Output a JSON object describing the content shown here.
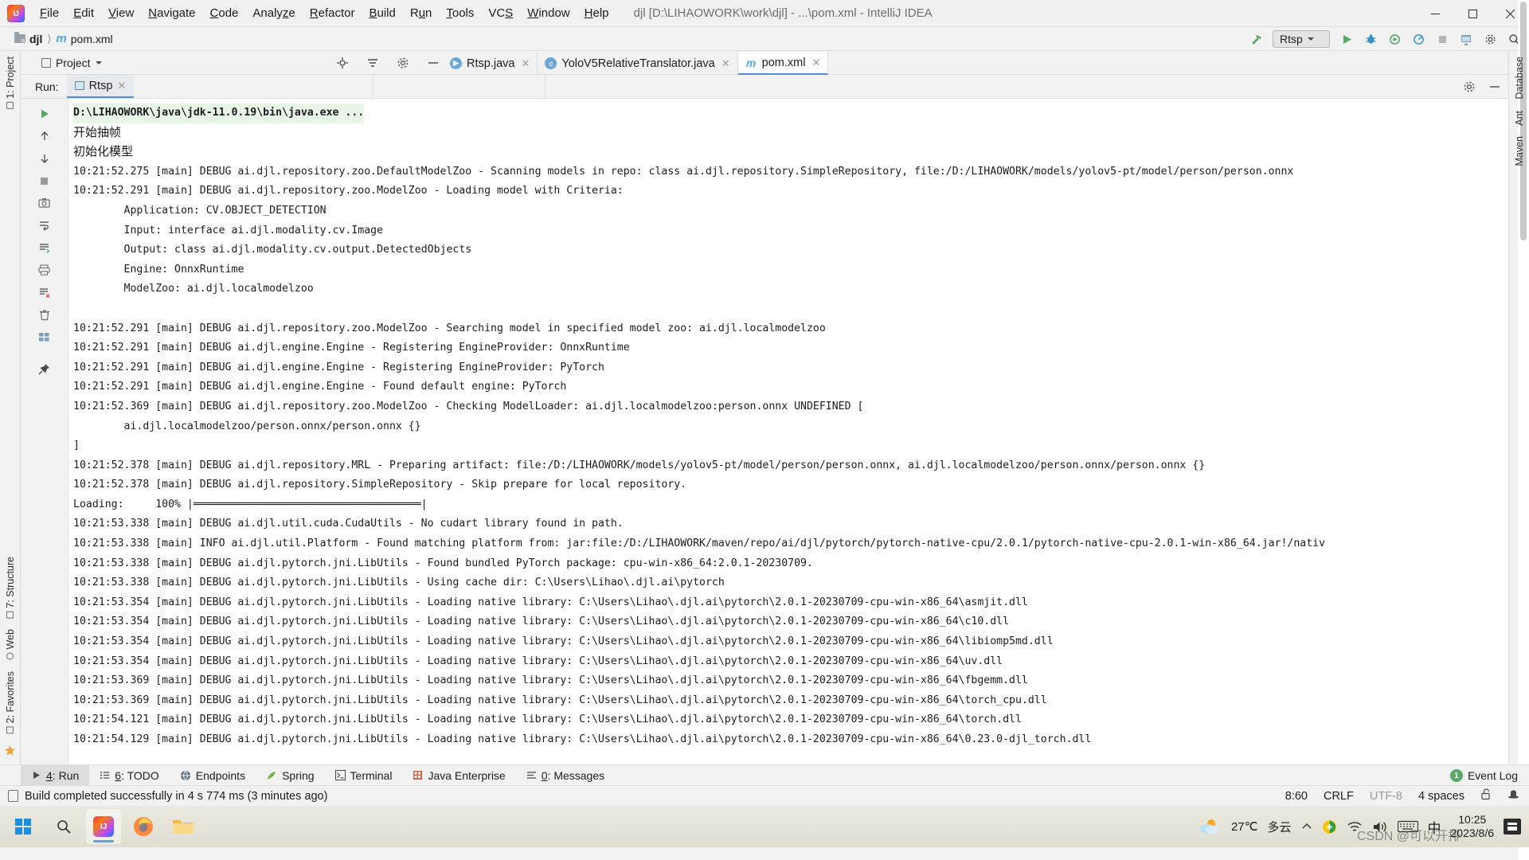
{
  "titlebar": {
    "logo": "intellij-logo",
    "menus": [
      "File",
      "Edit",
      "View",
      "Navigate",
      "Code",
      "Analyze",
      "Refactor",
      "Build",
      "Run",
      "Tools",
      "VCS",
      "Window",
      "Help"
    ],
    "window_title": "djl [D:\\LIHAOWORK\\work\\djl] - ...\\pom.xml - IntelliJ IDEA",
    "controls": [
      "minimize",
      "maximize",
      "close"
    ]
  },
  "navbar": {
    "crumbs": [
      "djl",
      "pom.xml"
    ],
    "separator": "〉",
    "run_config": "Rtsp",
    "icons": [
      "build-hammer-icon",
      "run-icon",
      "debug-icon",
      "run-coverage-icon",
      "profile-icon",
      "stop-icon",
      "updates-icon",
      "settings-icon",
      "search-everywhere-icon"
    ]
  },
  "tool_header": {
    "project_label": "Project",
    "icons": [
      "locate-icon",
      "collapse-all-icon",
      "settings-gear-icon",
      "hide-icon"
    ]
  },
  "editor_tabs": [
    {
      "label": "Rtsp.java",
      "icon": "java-run-icon",
      "active": false,
      "closable": true
    },
    {
      "label": "YoloV5RelativeTranslator.java",
      "icon": "java-class-icon",
      "active": false,
      "closable": true
    },
    {
      "label": "pom.xml",
      "icon": "maven-m-icon",
      "active": true,
      "closable": true
    }
  ],
  "run_panel": {
    "label": "Run:",
    "tab": "Rtsp",
    "gutter_icons": [
      "rerun-icon",
      "up-arrow-icon",
      "down-arrow-icon",
      "stop-icon",
      "camera-icon",
      "soft-wrap-icon",
      "scroll-to-end-icon",
      "print-icon",
      "clear-all-icon",
      "trash-icon",
      "layout-icon",
      "pin-icon"
    ],
    "header_icons": [
      "settings-gear-icon",
      "hide-icon"
    ]
  },
  "left_rail": {
    "top_tab": "1: Project",
    "bottom_tabs": [
      "7: Structure",
      "Web",
      "2: Favorites"
    ],
    "icons": [
      "project-icon",
      "structure-icon",
      "web-icon",
      "favorites-icon",
      "bookmarks-star-icon"
    ]
  },
  "right_rail": {
    "tabs": [
      "Database",
      "Ant",
      "Maven"
    ]
  },
  "console": {
    "lines": [
      {
        "text": "D:\\LIHAOWORK\\java\\jdk-11.0.19\\bin\\java.exe ...",
        "style": "cmd"
      },
      {
        "text": "开始抽帧",
        "style": "cn"
      },
      {
        "text": "初始化模型",
        "style": "cn"
      },
      {
        "text": "10:21:52.275 [main] DEBUG ai.djl.repository.zoo.DefaultModelZoo - Scanning models in repo: class ai.djl.repository.SimpleRepository, file:/D:/LIHAOWORK/models/yolov5-pt/model/person/person.onnx",
        "style": ""
      },
      {
        "text": "10:21:52.291 [main] DEBUG ai.djl.repository.zoo.ModelZoo - Loading model with Criteria:",
        "style": ""
      },
      {
        "text": "\tApplication: CV.OBJECT_DETECTION",
        "style": ""
      },
      {
        "text": "\tInput: interface ai.djl.modality.cv.Image",
        "style": ""
      },
      {
        "text": "\tOutput: class ai.djl.modality.cv.output.DetectedObjects",
        "style": ""
      },
      {
        "text": "\tEngine: OnnxRuntime",
        "style": ""
      },
      {
        "text": "\tModelZoo: ai.djl.localmodelzoo",
        "style": ""
      },
      {
        "text": "",
        "style": ""
      },
      {
        "text": "10:21:52.291 [main] DEBUG ai.djl.repository.zoo.ModelZoo - Searching model in specified model zoo: ai.djl.localmodelzoo",
        "style": ""
      },
      {
        "text": "10:21:52.291 [main] DEBUG ai.djl.engine.Engine - Registering EngineProvider: OnnxRuntime",
        "style": ""
      },
      {
        "text": "10:21:52.291 [main] DEBUG ai.djl.engine.Engine - Registering EngineProvider: PyTorch",
        "style": ""
      },
      {
        "text": "10:21:52.291 [main] DEBUG ai.djl.engine.Engine - Found default engine: PyTorch",
        "style": ""
      },
      {
        "text": "10:21:52.369 [main] DEBUG ai.djl.repository.zoo.ModelZoo - Checking ModelLoader: ai.djl.localmodelzoo:person.onnx UNDEFINED [",
        "style": ""
      },
      {
        "text": "\tai.djl.localmodelzoo/person.onnx/person.onnx {}",
        "style": ""
      },
      {
        "text": "]",
        "style": ""
      },
      {
        "text": "10:21:52.378 [main] DEBUG ai.djl.repository.MRL - Preparing artifact: file:/D:/LIHAOWORK/models/yolov5-pt/model/person/person.onnx, ai.djl.localmodelzoo/person.onnx/person.onnx {}",
        "style": ""
      },
      {
        "text": "10:21:52.378 [main] DEBUG ai.djl.repository.SimpleRepository - Skip prepare for local repository.",
        "style": ""
      },
      {
        "text": "Loading:     100% |════════════════════════════════════|",
        "style": ""
      },
      {
        "text": "10:21:53.338 [main] DEBUG ai.djl.util.cuda.CudaUtils - No cudart library found in path.",
        "style": ""
      },
      {
        "text": "10:21:53.338 [main] INFO ai.djl.util.Platform - Found matching platform from: jar:file:/D:/LIHAOWORK/maven/repo/ai/djl/pytorch/pytorch-native-cpu/2.0.1/pytorch-native-cpu-2.0.1-win-x86_64.jar!/nativ",
        "style": ""
      },
      {
        "text": "10:21:53.338 [main] DEBUG ai.djl.pytorch.jni.LibUtils - Found bundled PyTorch package: cpu-win-x86_64:2.0.1-20230709.",
        "style": ""
      },
      {
        "text": "10:21:53.338 [main] DEBUG ai.djl.pytorch.jni.LibUtils - Using cache dir: C:\\Users\\Lihao\\.djl.ai\\pytorch",
        "style": ""
      },
      {
        "text": "10:21:53.354 [main] DEBUG ai.djl.pytorch.jni.LibUtils - Loading native library: C:\\Users\\Lihao\\.djl.ai\\pytorch\\2.0.1-20230709-cpu-win-x86_64\\asmjit.dll",
        "style": ""
      },
      {
        "text": "10:21:53.354 [main] DEBUG ai.djl.pytorch.jni.LibUtils - Loading native library: C:\\Users\\Lihao\\.djl.ai\\pytorch\\2.0.1-20230709-cpu-win-x86_64\\c10.dll",
        "style": ""
      },
      {
        "text": "10:21:53.354 [main] DEBUG ai.djl.pytorch.jni.LibUtils - Loading native library: C:\\Users\\Lihao\\.djl.ai\\pytorch\\2.0.1-20230709-cpu-win-x86_64\\libiomp5md.dll",
        "style": ""
      },
      {
        "text": "10:21:53.354 [main] DEBUG ai.djl.pytorch.jni.LibUtils - Loading native library: C:\\Users\\Lihao\\.djl.ai\\pytorch\\2.0.1-20230709-cpu-win-x86_64\\uv.dll",
        "style": ""
      },
      {
        "text": "10:21:53.369 [main] DEBUG ai.djl.pytorch.jni.LibUtils - Loading native library: C:\\Users\\Lihao\\.djl.ai\\pytorch\\2.0.1-20230709-cpu-win-x86_64\\fbgemm.dll",
        "style": ""
      },
      {
        "text": "10:21:53.369 [main] DEBUG ai.djl.pytorch.jni.LibUtils - Loading native library: C:\\Users\\Lihao\\.djl.ai\\pytorch\\2.0.1-20230709-cpu-win-x86_64\\torch_cpu.dll",
        "style": ""
      },
      {
        "text": "10:21:54.121 [main] DEBUG ai.djl.pytorch.jni.LibUtils - Loading native library: C:\\Users\\Lihao\\.djl.ai\\pytorch\\2.0.1-20230709-cpu-win-x86_64\\torch.dll",
        "style": ""
      },
      {
        "text": "10:21:54.129 [main] DEBUG ai.djl.pytorch.jni.LibUtils - Loading native library: C:\\Users\\Lihao\\.djl.ai\\pytorch\\2.0.1-20230709-cpu-win-x86_64\\0.23.0-djl_torch.dll",
        "style": ""
      }
    ]
  },
  "toolwindow_bar": {
    "items": [
      {
        "num": "4",
        "label": "Run",
        "icon": "run-triangle-icon",
        "active": true
      },
      {
        "num": "6",
        "label": "TODO",
        "icon": "todo-list-icon",
        "active": false
      },
      {
        "num": "",
        "label": "Endpoints",
        "icon": "endpoints-globe-icon",
        "active": false
      },
      {
        "num": "",
        "label": "Spring",
        "icon": "spring-leaf-icon",
        "active": false
      },
      {
        "num": "",
        "label": "Terminal",
        "icon": "terminal-icon",
        "active": false
      },
      {
        "num": "",
        "label": "Java Enterprise",
        "icon": "java-enterprise-icon",
        "active": false
      },
      {
        "num": "0",
        "label": "Messages",
        "icon": "messages-icon",
        "active": false
      }
    ],
    "event_log": "Event Log",
    "event_log_count": "1"
  },
  "statusbar": {
    "message": "Build completed successfully in 4 s 774 ms (3 minutes ago)",
    "caret": "8:60",
    "line_sep": "CRLF",
    "encoding": "UTF-8",
    "indent": "4 spaces",
    "icons": [
      "build-doc-icon",
      "lock-open-icon",
      "inspector-hat-icon"
    ]
  },
  "taskbar": {
    "start": "windows-start-icon",
    "search": "search-icon",
    "apps": [
      "intellij-idea-icon",
      "firefox-icon",
      "file-explorer-icon"
    ],
    "tray": {
      "weather_temp": "27℃",
      "weather_desc": "多云",
      "weather_icon": "sun-cloud-icon",
      "chevron": "show-hidden-icons-icon",
      "icons": [
        "security-shield-icon",
        "network-wifi-icon",
        "volume-icon",
        "keyboard-icon"
      ],
      "ime": "中",
      "time": "10:25",
      "date": "2023/8/6",
      "notifications": "notification-icon"
    }
  },
  "watermark": "CSDN @可以开排"
}
